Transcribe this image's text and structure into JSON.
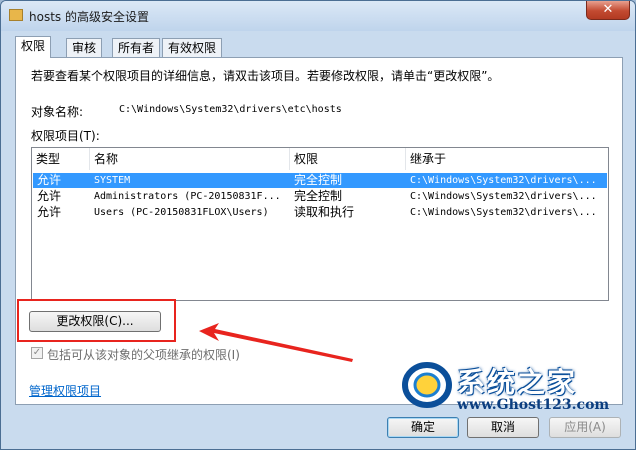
{
  "window": {
    "title": "hosts 的高级安全设置",
    "close_label": "✕"
  },
  "tabs": [
    {
      "label": "权限"
    },
    {
      "label": "审核"
    },
    {
      "label": "所有者"
    },
    {
      "label": "有效权限"
    }
  ],
  "panel": {
    "instruction": "若要查看某个权限项目的详细信息，请双击该项目。若要修改权限，请单击“更改权限”。",
    "object_name_label": "对象名称:",
    "object_name_value": "C:\\Windows\\System32\\drivers\\etc\\hosts",
    "entries_label": "权限项目(T):"
  },
  "list": {
    "columns": [
      "类型",
      "名称",
      "权限",
      "继承于"
    ],
    "rows": [
      {
        "type": "允许",
        "name": "SYSTEM",
        "permission": "完全控制",
        "inherited": "C:\\Windows\\System32\\drivers\\..."
      },
      {
        "type": "允许",
        "name": "Administrators (PC-20150831F...",
        "permission": "完全控制",
        "inherited": "C:\\Windows\\System32\\drivers\\..."
      },
      {
        "type": "允许",
        "name": "Users (PC-20150831FLOX\\Users)",
        "permission": "读取和执行",
        "inherited": "C:\\Windows\\System32\\drivers\\..."
      }
    ]
  },
  "buttons": {
    "change_permissions": "更改权限(C)...",
    "ok": "确定",
    "cancel": "取消",
    "apply": "应用(A)"
  },
  "checkbox": {
    "label": "包括可从该对象的父项继承的权限(I)",
    "check_glyph": "✓"
  },
  "links": {
    "manage_entries": "管理权限项目"
  },
  "watermark": {
    "text": "系统之家",
    "url": "www.Ghost123.com"
  },
  "colors": {
    "highlight": "#e8241e",
    "selection": "#3399ff",
    "link": "#0066cc"
  }
}
